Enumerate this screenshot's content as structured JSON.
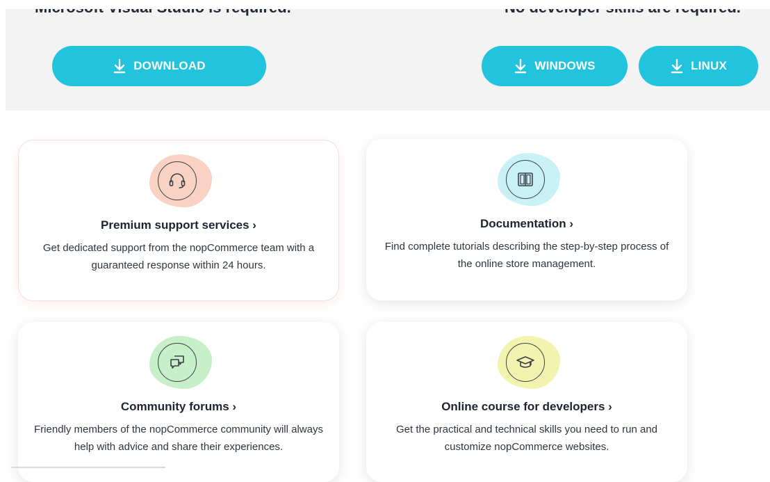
{
  "top_section": {
    "left_heading": "Microsoft Visual Studio is required.",
    "right_heading": "No developer skills are required.",
    "download_button": {
      "label": "DOWNLOAD",
      "icon": "download-arrow-icon"
    },
    "windows_button": {
      "label": "WINDOWS",
      "icon": "download-arrow-icon"
    },
    "linux_button": {
      "label": "LINUX",
      "icon": "download-arrow-icon"
    }
  },
  "cards": [
    {
      "title": "Premium support services ›",
      "description": "Get dedicated support from the nopCommerce team with a guaranteed response within 24 hours.",
      "icon": "headset-icon",
      "blob_color": "#f9d2c4"
    },
    {
      "title": "Documentation ›",
      "description": "Find complete tutorials describing the step-by-step process of the online store management.",
      "icon": "book-icon",
      "blob_color": "#c9f1f6"
    },
    {
      "title": "Community forums ›",
      "description": "Friendly members of the nopCommerce community will always help with advice and share their experiences.",
      "icon": "chat-bubbles-icon",
      "blob_color": "#c8f0c8"
    },
    {
      "title": "Online course for developers ›",
      "description": "Get the practical and technical skills you need to run and customize nopCommerce websites.",
      "icon": "graduation-cap-icon",
      "blob_color": "#f3f3b0"
    }
  ],
  "colors": {
    "accent": "#22c3dd",
    "band_background": "#f3f3f3",
    "text_dark": "#1f2330"
  }
}
